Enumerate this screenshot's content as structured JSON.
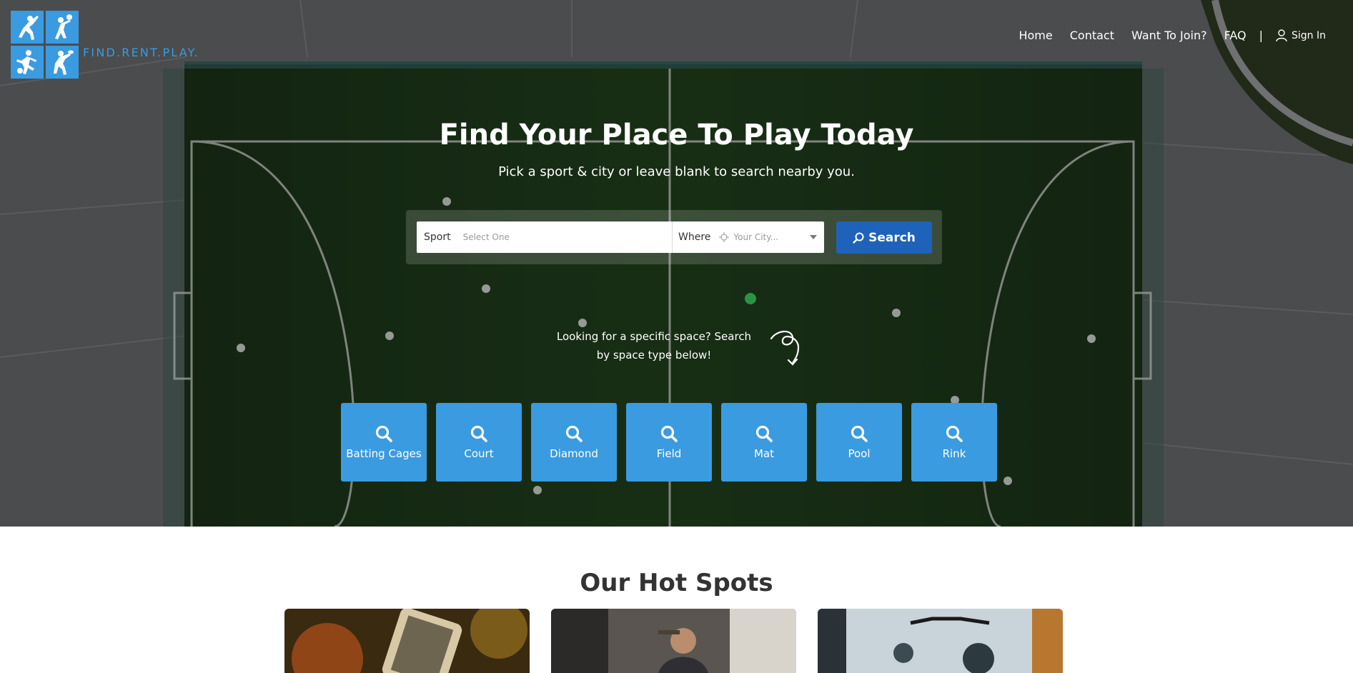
{
  "logo": {
    "text": "FIND.RENT.PLAY."
  },
  "nav": {
    "items": [
      "Home",
      "Contact",
      "Want To Join?",
      "FAQ"
    ],
    "separator": "|",
    "signin": "Sign In",
    "signin_icon": "user-icon"
  },
  "hero": {
    "title": "Find Your Place To Play Today",
    "subtitle": "Pick a sport & city or leave blank to search nearby you."
  },
  "search": {
    "sport_label": "Sport",
    "sport_placeholder": "Select One",
    "where_label": "Where",
    "where_placeholder": "Your City...",
    "button_label": "Search",
    "button_color": "#1e63b9"
  },
  "hint": {
    "text": "Looking for a specific space? Search by space type below!"
  },
  "space_types": [
    {
      "label": "Batting Cages",
      "icon": "search-icon"
    },
    {
      "label": "Court",
      "icon": "search-icon"
    },
    {
      "label": "Diamond",
      "icon": "search-icon"
    },
    {
      "label": "Field",
      "icon": "search-icon"
    },
    {
      "label": "Mat",
      "icon": "search-icon"
    },
    {
      "label": "Pool",
      "icon": "search-icon"
    },
    {
      "label": "Rink",
      "icon": "search-icon"
    }
  ],
  "hot_spots": {
    "title": "Our Hot Spots"
  },
  "colors": {
    "accent": "#3a9be0",
    "primary_button": "#1e63b9"
  }
}
